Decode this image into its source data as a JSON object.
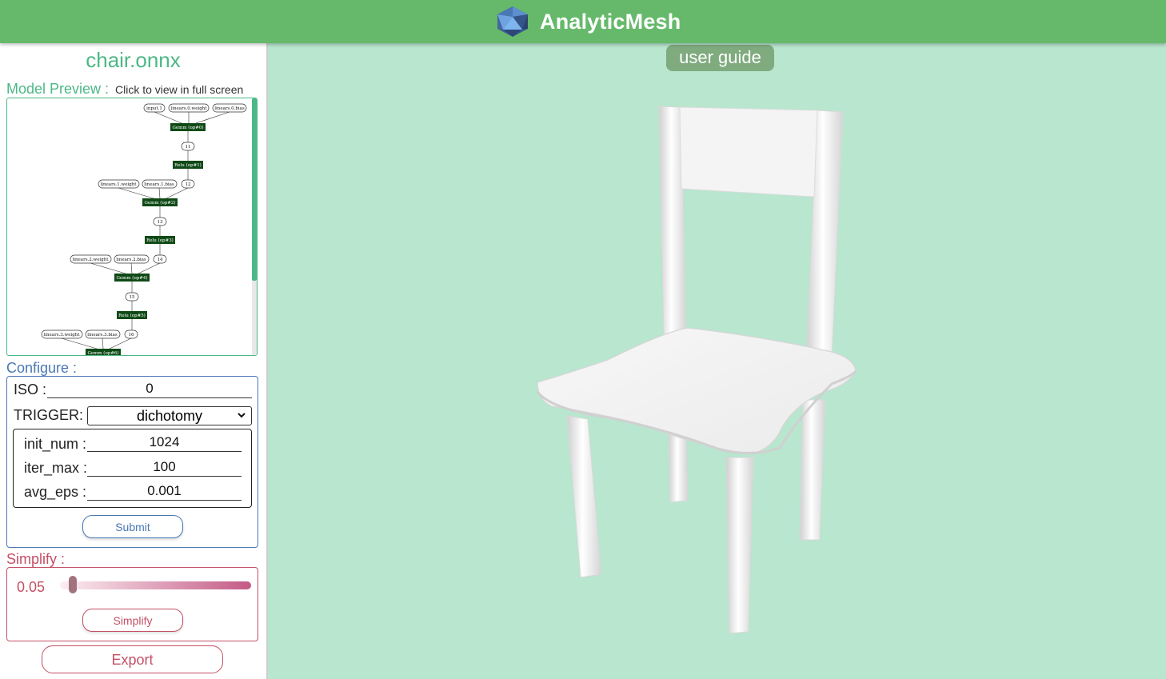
{
  "app": {
    "title": "AnalyticMesh",
    "logo_icon": "icosahedron-logo-icon"
  },
  "header": {
    "guide_label": "user guide"
  },
  "file": {
    "name": "chair.onnx"
  },
  "preview": {
    "label": "Model Preview :",
    "hint": "Click to view in full screen",
    "graph_nodes": [
      "input.1",
      "linears.0.weight",
      "linears.0.bias",
      "Gemm (op#0)",
      "11",
      "Relu (op#1)",
      "linears.1.weight",
      "linears.1.bias",
      "12",
      "Gemm (op#2)",
      "13",
      "Relu (op#3)",
      "linears.2.weight",
      "linears.2.bias",
      "14",
      "Gemm (op#4)",
      "15",
      "Relu (op#5)",
      "linears.3.weight",
      "linears.3.bias",
      "16",
      "Gemm (op#6)"
    ]
  },
  "configure": {
    "label": "Configure :",
    "iso_label": "ISO :",
    "iso_value": "0",
    "trigger_label": "TRIGGER:",
    "trigger_value": "dichotomy",
    "init_num_label": "init_num :",
    "init_num_value": "1024",
    "iter_max_label": "iter_max :",
    "iter_max_value": "100",
    "avg_eps_label": "avg_eps :",
    "avg_eps_value": "0.001",
    "submit_label": "Submit"
  },
  "simplify": {
    "label": "Simplify :",
    "value": "0.05",
    "level": 0.05,
    "button_label": "Simplify"
  },
  "export": {
    "label": "Export"
  },
  "colors": {
    "header": "#66b96a",
    "accent_green": "#4cb886",
    "accent_blue": "#4a77b5",
    "accent_pink": "#c45066",
    "viewport_bg": "#b8e6cf"
  }
}
